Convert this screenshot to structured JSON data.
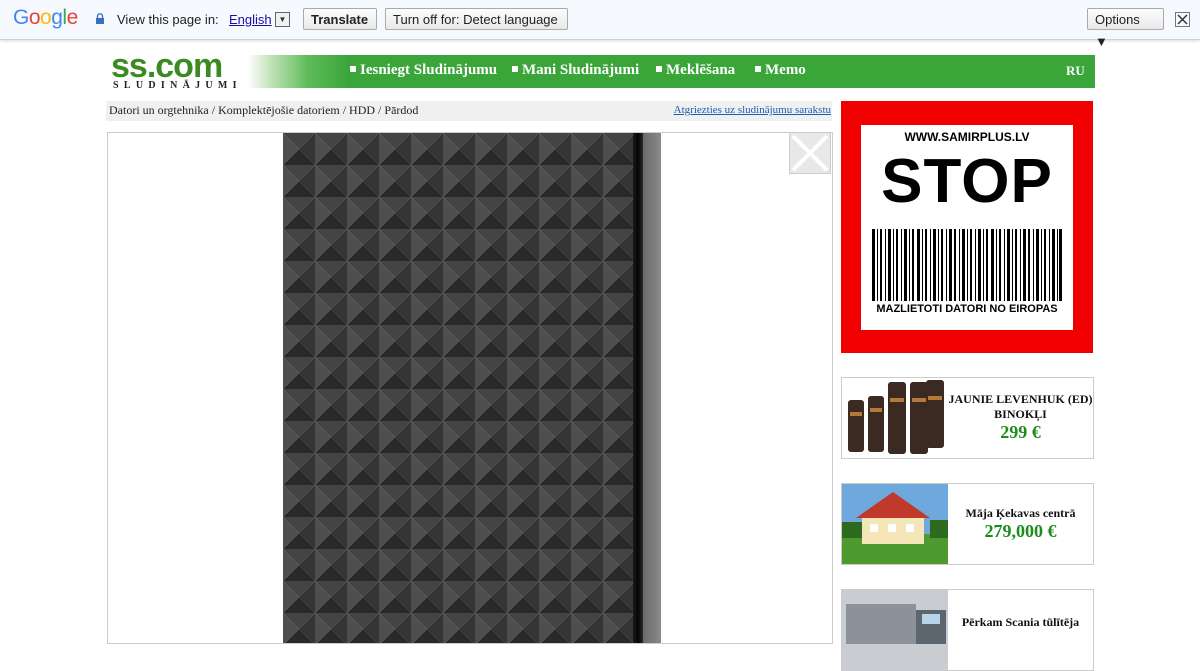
{
  "translate_bar": {
    "logo_letters": [
      "G",
      "o",
      "o",
      "g",
      "l",
      "e"
    ],
    "logo_colors": [
      "#4285f4",
      "#ea4335",
      "#fbbc05",
      "#4285f4",
      "#34a853",
      "#ea4335"
    ],
    "prompt": "View this page in:",
    "language": "English",
    "translate_label": "Translate",
    "turn_off_label": "Turn off for: Detect language",
    "options_label": "Options ▼"
  },
  "header": {
    "logo_main": "ss.com",
    "logo_sub": "SLUDINĀJUMI",
    "nav": [
      {
        "label": "Iesniegt Sludinājumu"
      },
      {
        "label": "Mani Sludinājumi"
      },
      {
        "label": "Meklēšana"
      },
      {
        "label": "Memo"
      }
    ],
    "lang_switch": "RU",
    "accent": "#3aa63a"
  },
  "breadcrumb": {
    "path": "Datori un orgtehnika / Komplektējošie datoriem / HDD / Pārdod",
    "back_link": "Atgriezties uz sludinājumu sarakstu"
  },
  "ads": {
    "stop": {
      "url": "WWW.SAMIRPLUS.LV",
      "headline": "STOP",
      "footer": "MAZLIETOTI DATORI NO EIROPAS"
    },
    "items": [
      {
        "title": "JAUNIE LEVENHUK (ED) BINOKĻI",
        "price": "299 €"
      },
      {
        "title": "Māja Ķekavas centrā",
        "price": "279,000 €"
      },
      {
        "title": "Pērkam Scania tūlītēja",
        "price": ""
      }
    ]
  }
}
